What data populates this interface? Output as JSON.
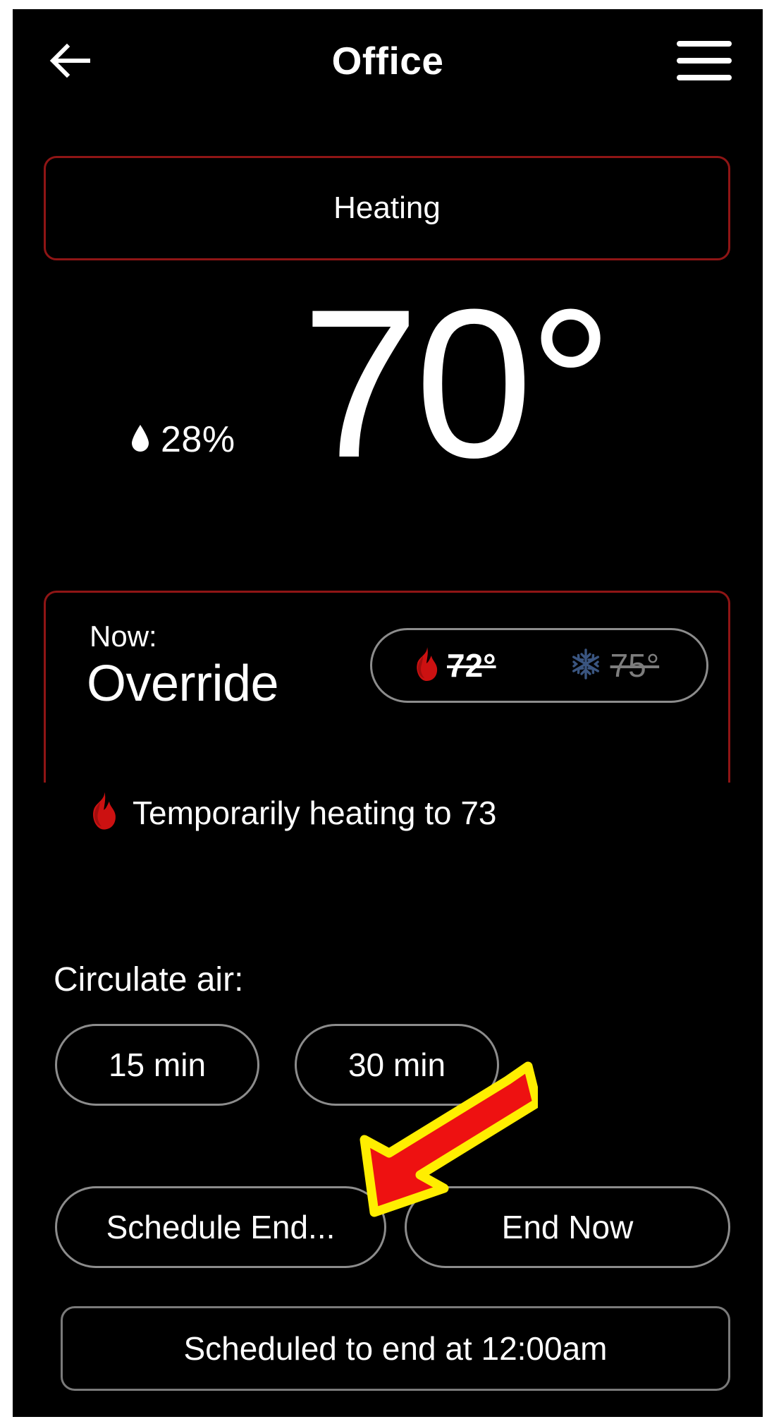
{
  "header": {
    "title": "Office",
    "back_icon": "arrow-left-icon",
    "menu_icon": "hamburger-menu-icon"
  },
  "mode_card": {
    "label": "Heating",
    "border_color": "#8f1515"
  },
  "current": {
    "temperature": "70°",
    "humidity": "28%",
    "humidity_icon": "water-drop-icon"
  },
  "override_card": {
    "now_label": "Now:",
    "state": "Override",
    "border_color": "#8f1515",
    "setpoints": {
      "heat": {
        "icon": "flame-icon",
        "icon_color": "#cc1111",
        "value": "72°",
        "struck_through": true,
        "text_color": "#ffffff"
      },
      "cool": {
        "icon": "snowflake-icon",
        "icon_color": "#3a5580",
        "value": "75°",
        "struck_through": true,
        "text_color": "#7d7d7d"
      }
    }
  },
  "override_status": {
    "icon": "flame-icon",
    "text": "Temporarily heating to 73"
  },
  "circulate": {
    "label": "Circulate air:",
    "options": [
      {
        "label": "15 min"
      },
      {
        "label": "30 min"
      }
    ]
  },
  "override_actions": [
    {
      "label": "Schedule End..."
    },
    {
      "label": "End Now"
    }
  ],
  "scheduled_end": {
    "label": "Scheduled to end at 12:00am"
  },
  "annotation": {
    "type": "arrow",
    "direction": "down-left",
    "target": "Schedule End...",
    "fill_color": "#ee1111",
    "outline_color": "#ffee00"
  }
}
